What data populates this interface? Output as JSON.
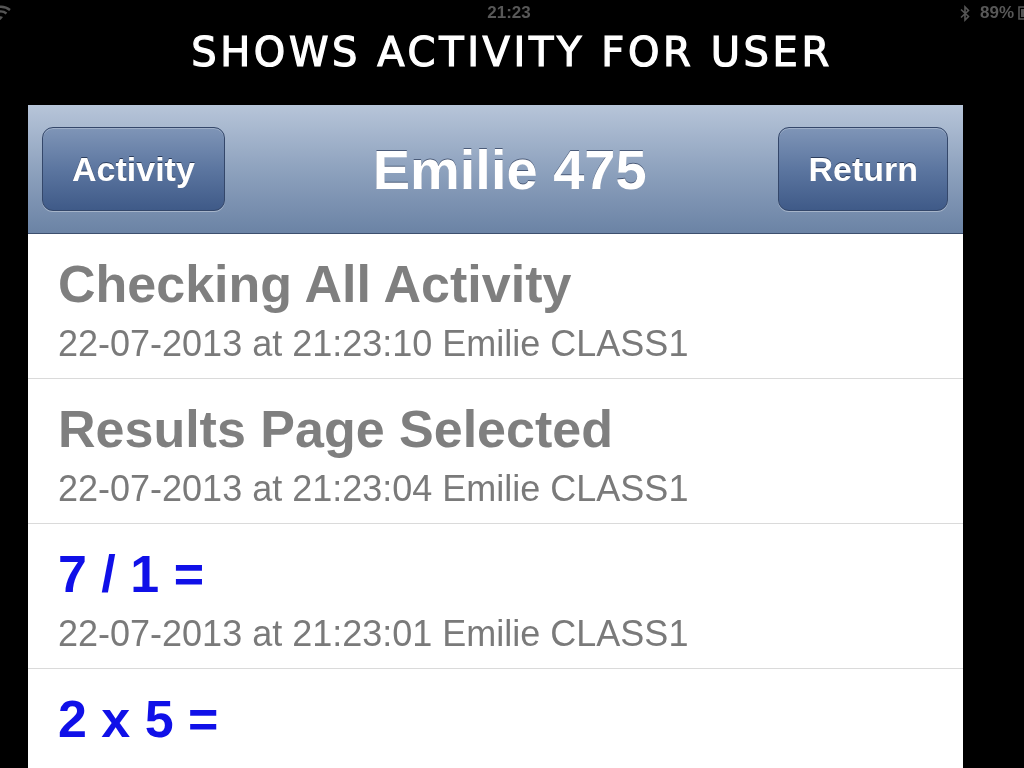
{
  "status_bar": {
    "time": "21:23",
    "battery": "89%"
  },
  "caption": "SHOWS ACTIVITY FOR USER",
  "nav_bar": {
    "left_button": "Activity",
    "title": "Emilie 475",
    "right_button": "Return"
  },
  "activity_list": [
    {
      "kind": "event",
      "title": "Checking All Activity",
      "detail": "22-07-2013 at 21:23:10 Emilie CLASS1"
    },
    {
      "kind": "event",
      "title": "Results Page Selected",
      "detail": "22-07-2013 at 21:23:04 Emilie CLASS1"
    },
    {
      "kind": "question",
      "title": "7 / 1 =",
      "detail": "22-07-2013 at 21:23:01 Emilie CLASS1"
    },
    {
      "kind": "question",
      "title": "2 x 5 ="
    }
  ]
}
